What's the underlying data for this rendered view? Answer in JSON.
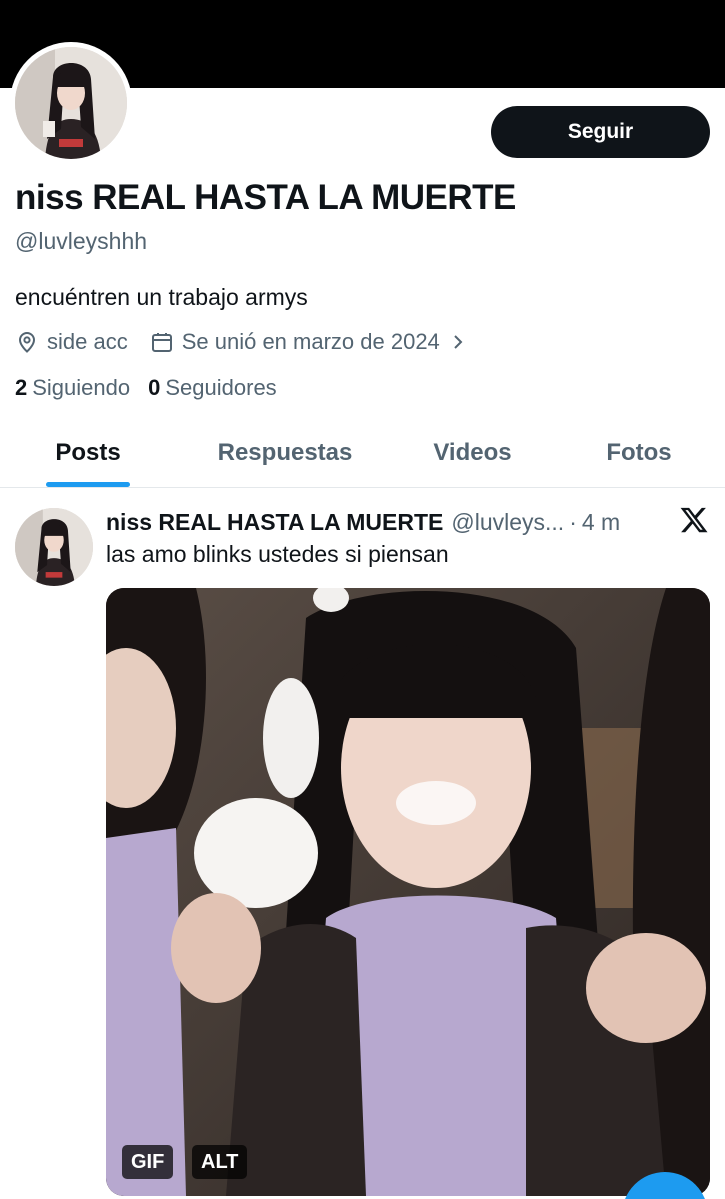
{
  "profile": {
    "display_name": "niss REAL HASTA LA MUERTE",
    "handle": "@luvleyshhh",
    "bio": "encuéntren un trabajo armys",
    "location": "side acc",
    "joined": "Se unió en marzo de 2024",
    "following_count": "2",
    "following_label": "Siguiendo",
    "followers_count": "0",
    "followers_label": "Seguidores",
    "follow_button": "Seguir"
  },
  "tabs": [
    {
      "label": "Posts",
      "active": true
    },
    {
      "label": "Respuestas",
      "active": false
    },
    {
      "label": "Videos",
      "active": false
    },
    {
      "label": "Fotos",
      "active": false
    }
  ],
  "post": {
    "author_name": "niss REAL HASTA LA MUERTE",
    "author_handle": "@luvleys...",
    "separator": "·",
    "time": "4 m",
    "text": "las amo blinks ustedes si piensan",
    "media_badges": [
      "GIF",
      "ALT"
    ]
  },
  "icons": {
    "location": "location-pin-icon",
    "calendar": "calendar-icon",
    "chevron": "chevron-right-icon",
    "brand": "x-logo-icon"
  },
  "colors": {
    "accent": "#1d9bf0",
    "text_primary": "#0f1419",
    "text_secondary": "#536471",
    "button_bg": "#0f1419"
  }
}
